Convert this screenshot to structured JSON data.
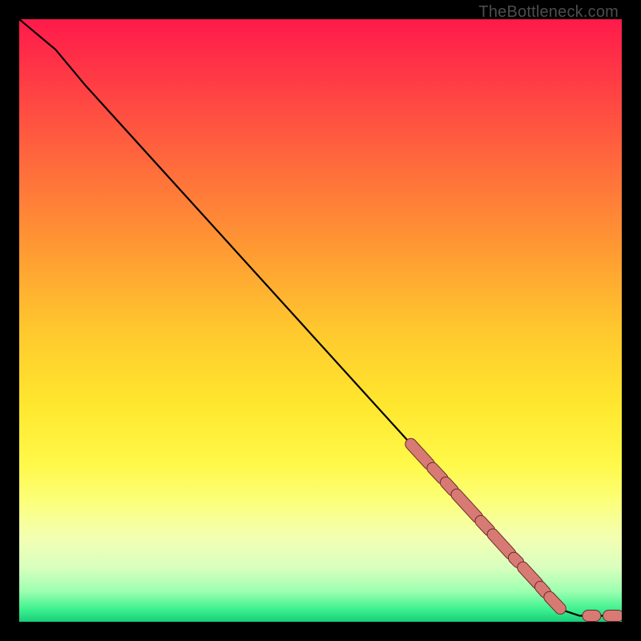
{
  "attribution": "TheBottleneck.com",
  "colors": {
    "marker_fill": "#d87a74",
    "marker_stroke": "#6b2a2a",
    "curve": "#000000"
  },
  "chart_data": {
    "type": "line",
    "title": "",
    "xlabel": "",
    "ylabel": "",
    "xlim": [
      0,
      100
    ],
    "ylim": [
      0,
      100
    ],
    "curve": [
      {
        "x": 0,
        "y": 100
      },
      {
        "x": 6,
        "y": 95
      },
      {
        "x": 11,
        "y": 89
      },
      {
        "x": 65,
        "y": 29.5
      },
      {
        "x": 90,
        "y": 2
      },
      {
        "x": 93,
        "y": 1
      },
      {
        "x": 100,
        "y": 1
      }
    ],
    "marker_segments": [
      {
        "x1": 65.0,
        "y1": 29.5,
        "x2": 68.0,
        "y2": 26.2
      },
      {
        "x1": 68.6,
        "y1": 25.5,
        "x2": 70.2,
        "y2": 23.8
      },
      {
        "x1": 70.8,
        "y1": 23.1,
        "x2": 72.0,
        "y2": 21.8
      },
      {
        "x1": 72.6,
        "y1": 21.1,
        "x2": 76.0,
        "y2": 17.4
      },
      {
        "x1": 76.6,
        "y1": 16.7,
        "x2": 78.0,
        "y2": 15.2
      },
      {
        "x1": 78.6,
        "y1": 14.5,
        "x2": 81.5,
        "y2": 11.3
      },
      {
        "x1": 82.1,
        "y1": 10.6,
        "x2": 82.8,
        "y2": 9.9
      },
      {
        "x1": 83.6,
        "y1": 9.0,
        "x2": 86.0,
        "y2": 6.4
      },
      {
        "x1": 86.5,
        "y1": 5.8,
        "x2": 87.3,
        "y2": 4.9
      },
      {
        "x1": 88.0,
        "y1": 4.1,
        "x2": 89.8,
        "y2": 2.2
      },
      {
        "x1": 94.4,
        "y1": 1.0,
        "x2": 95.6,
        "y2": 1.0
      },
      {
        "x1": 97.8,
        "y1": 1.0,
        "x2": 99.4,
        "y2": 1.0
      }
    ]
  }
}
